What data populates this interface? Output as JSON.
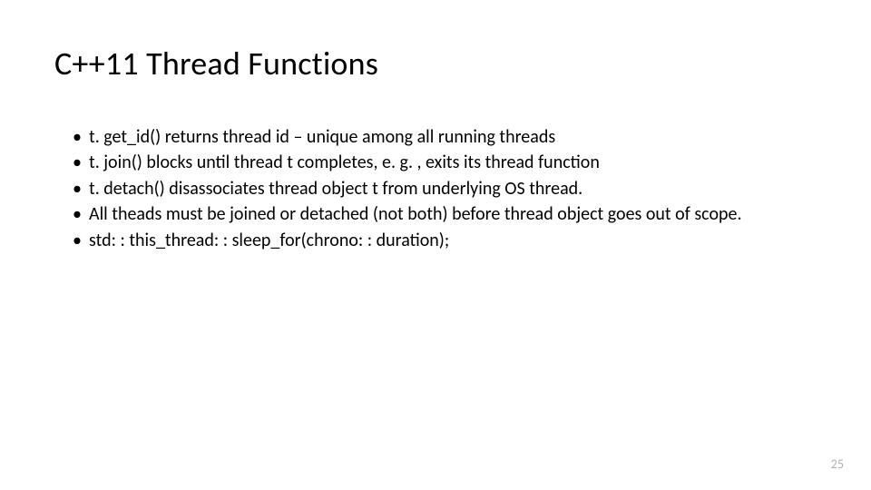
{
  "title": "C++11 Thread Functions",
  "bullets": {
    "b1": "t. get_id() returns thread id – unique among all running threads",
    "b2": "t. join() blocks until thread t completes, e. g. , exits its thread function",
    "b3": "t. detach() disassociates thread object t from underlying OS thread.",
    "b4": "All theads must be joined or detached (not both) before thread object goes out of scope.",
    "b5": "std: : this_thread: : sleep_for(chrono: : duration);"
  },
  "page_number": "25"
}
